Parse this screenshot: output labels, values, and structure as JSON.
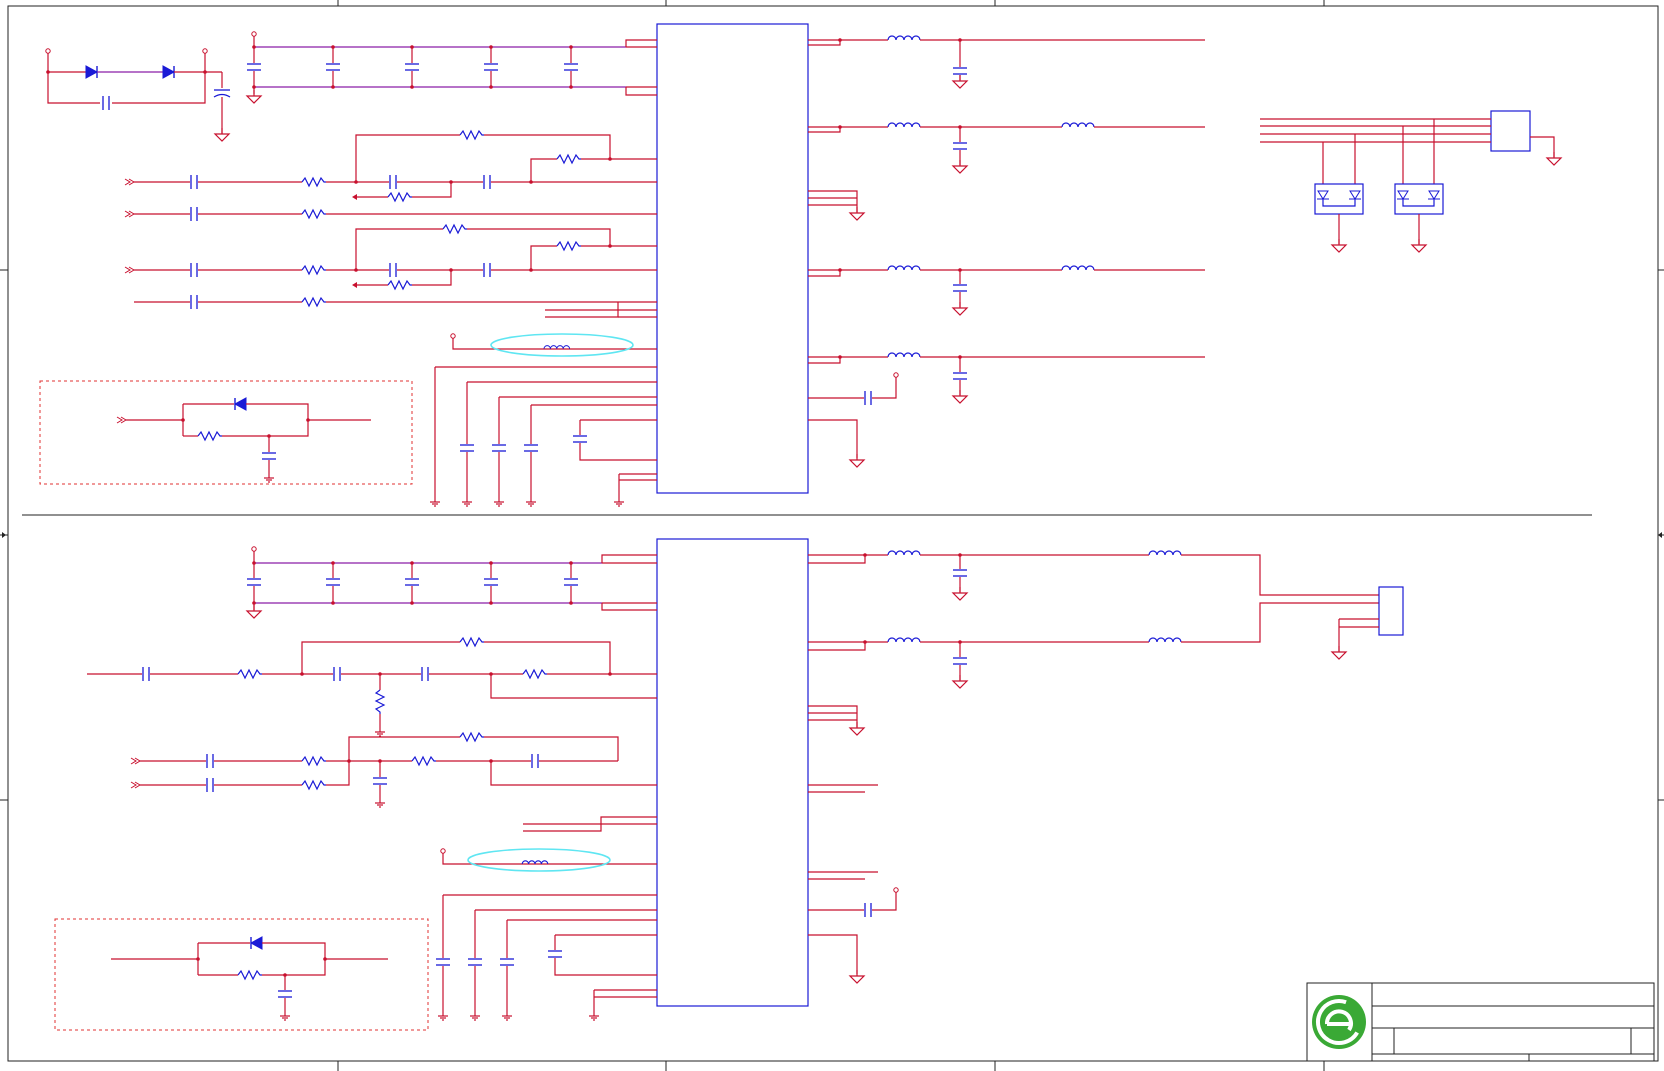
{
  "sheet": {
    "title_block": {
      "logo": "company-logo"
    }
  },
  "colors": {
    "wire": "#c8102e",
    "wire_alt": "#8a1ea8",
    "component": "#1a1ad6",
    "ferrite_marker": "#5fe6f2",
    "subcircuit_box": "#e03030",
    "logo_green": "#3aa935",
    "frame": "#222222"
  },
  "symbols": [
    "capacitor",
    "resistor",
    "inductor",
    "diode",
    "ground",
    "power-port",
    "connector",
    "tvs-diode",
    "ic"
  ]
}
